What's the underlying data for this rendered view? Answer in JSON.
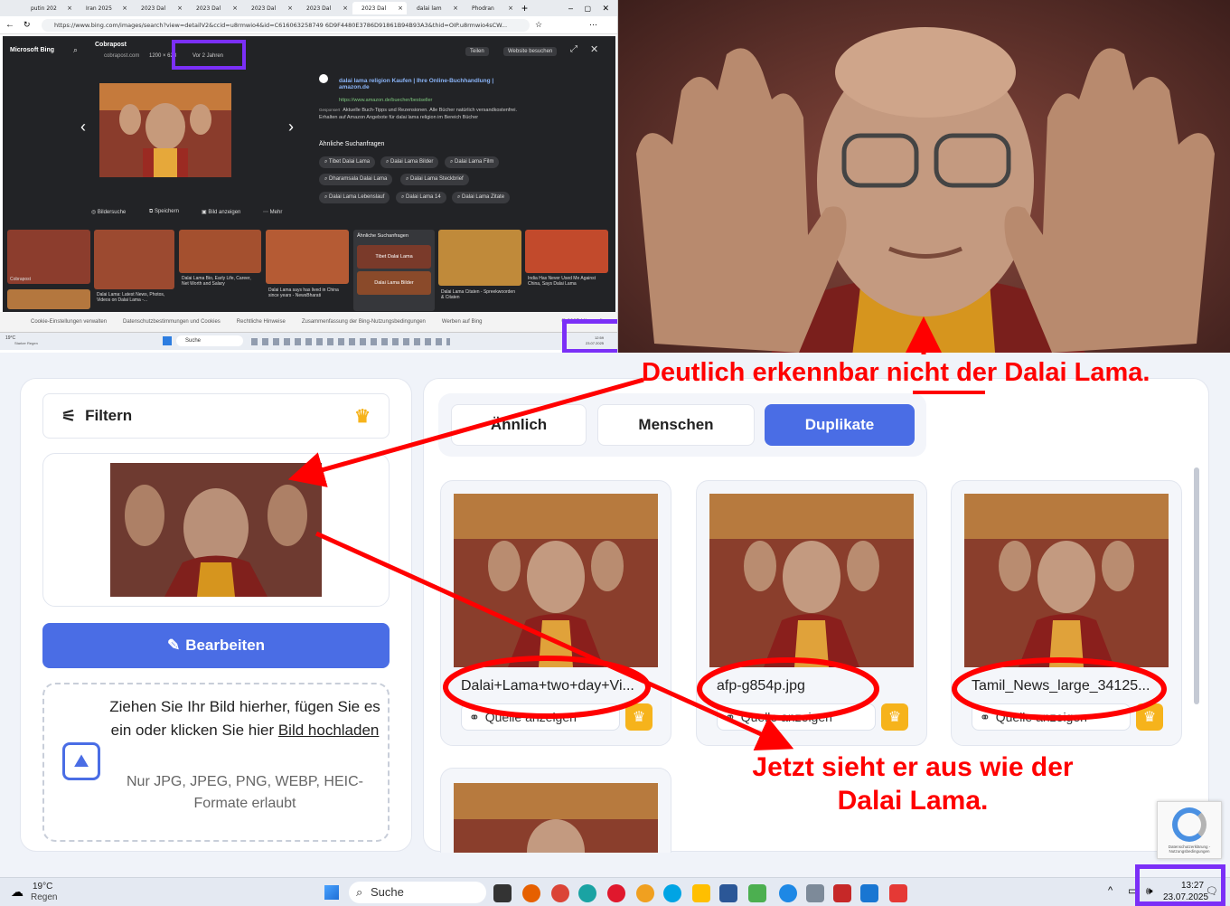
{
  "browser": {
    "tabs": [
      "putin 202",
      "Iran 2025",
      "2023 Dal",
      "2023 Dal",
      "2023 Dal",
      "2023 Dal",
      "2023 Dal",
      "2023 Dal",
      "dalai lam",
      "Phodran"
    ],
    "url": "https://www.bing.com/images/search?view=detailV2&ccid=u8rmwio4&id=C616063258749 6D9F4480E3786D91861B94B93A3&thid=OIP.u8rmwio4sCW...",
    "bing": {
      "logo": "Microsoft Bing",
      "source_name": "Cobrapost",
      "source_url": "cobrapost.com",
      "dims": "1200 × 628",
      "age": "Vor 2 Jahren",
      "share": "Teilen",
      "visit": "Website besuchen",
      "ad_title": "dalai lama religion Kaufen | Ihre Online-Buchhandlung | amazon.de",
      "ad_url": "https://www.amazon.de/buecher/bestseller",
      "ad_tag": "Gesponsert",
      "ad_text": "Aktuelle Buch-Tipps und Rezensionen. Alle Bücher natürlich versandkostenfrei. Erhalten auf Amazon Angebote für dalai lama religion im Bereich Bücher",
      "related_heading": "Ähnliche Suchanfragen",
      "chips": [
        "Tibet Dalai Lama",
        "Dalai Lama Bilder",
        "Dalai Lama Film",
        "Dharamsala Dalai Lama",
        "Dalai Lama Steckbrief",
        "Dalai Lama Lebenslauf",
        "Dalai Lama 14",
        "Dalai Lama Zitate"
      ],
      "actions": [
        "Bildersuche",
        "Speichern",
        "Bild anzeigen",
        "Mehr"
      ],
      "thumb_caps": [
        "Cobrapost",
        "Dalai Lama: Latest News, Photos, Videos on Dalai Lama -...",
        "Dalai Lama Bio, Early Life, Career, Net Worth and Salary",
        "Dalai Lama says has lived in China since years - NewsBharati",
        "Ähnliche Suchanfragen",
        "Dalai Lama Citaten - Spreekwoorden & Citaten",
        "India Has Never Used Me Against China, Says Dalai Lama"
      ],
      "related_mini": [
        "Tibet Dalai Lama",
        "Dalai Lama Bilder"
      ],
      "footer": [
        "Cookie-Einstellungen verwalten",
        "Datenschutzbestimmungen und Cookies",
        "Rechtliche Hinweise",
        "Zusammenfassung der Bing-Nutzungsbedingungen",
        "Werben auf Bing",
        "© 2025 Microsoft"
      ],
      "mini_search": "Suche",
      "mini_weather": "19°C",
      "mini_weather_desc": "Starker Regen",
      "mini_time": "12:59",
      "mini_date": "23.07.2025"
    }
  },
  "tool": {
    "filter_label": "Filtern",
    "tabs": [
      "Ähnlich",
      "Menschen",
      "Duplikate"
    ],
    "edit_button": "Bearbeiten",
    "upload_text_a": "Ziehen Sie Ihr Bild hierher, fügen Sie es ein oder klicken Sie hier",
    "upload_link": "Bild hochladen",
    "upload_formats": "Nur JPG, JPEG, PNG, WEBP, HEIC-Formate erlaubt",
    "results": [
      {
        "filename": "Dalai+Lama+two+day+Vi..."
      },
      {
        "filename": "afp-g854p.jpg"
      },
      {
        "filename": "Tamil_News_large_34125..."
      }
    ],
    "source_label": "Quelle anzeigen",
    "recaptcha": "Datenschutzerklärung - Nutzungsbedingungen"
  },
  "annotations": {
    "top": "Deutlich erkennbar nicht der Dalai Lama.",
    "bottom_line1": "Jetzt sieht er aus wie der",
    "bottom_line2": "Dalai Lama.",
    "color": "#ff0000",
    "highlight": "#7b2ff7"
  },
  "taskbar": {
    "temp": "19°C",
    "weather": "Regen",
    "search": "Suche",
    "time": "13:27",
    "date": "23.07.2025"
  }
}
